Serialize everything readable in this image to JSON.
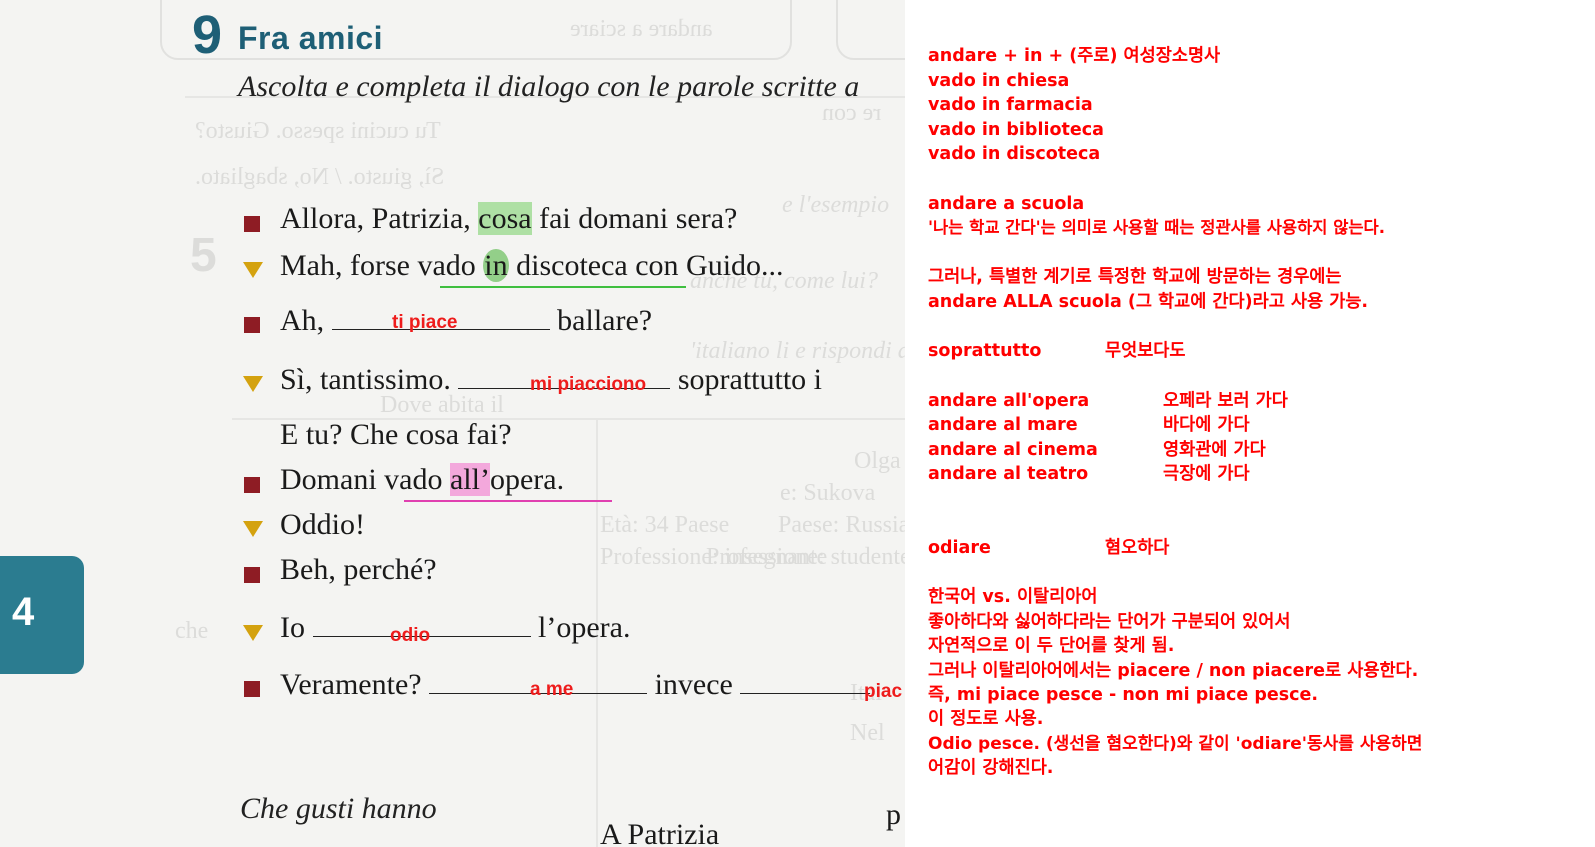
{
  "exercise": {
    "number": "9",
    "title": "Fra amici",
    "instruction": "Ascolta e completa il dialogo con le parole scritte a",
    "section_tab": "4",
    "footer_left": "Che gusti hanno",
    "footer_mid": "A Patrizia",
    "footer_right": "p"
  },
  "ghost_text": {
    "top_box": "andare a sciare",
    "q1": "Tu cucini spesso. Giusto?",
    "q2": "Sì, giusto. / No, sbagliato.",
    "frag1": "re con",
    "frag2": "e l'esempio",
    "num5": "5",
    "frag3": "anche tu, come lui?",
    "frag4": "'italiano li e rispondi alle domande",
    "frag5": "Dove abita il",
    "frag6": "Olga",
    "frag7": "e: Sukova",
    "frag8": "Paese: Russia",
    "frag9": "Età: 34 Paese",
    "frag10": "Professione: studentessa",
    "frag11": "Professione: insegnante",
    "frag12": "che",
    "frag13": "Ital",
    "frag14": "Nel"
  },
  "dialogue": {
    "l1": {
      "pre": "Allora, Patrizia, ",
      "hl": "cosa",
      "post": " fai domani sera?"
    },
    "l2": {
      "pre": "Mah, forse vado ",
      "hl": "in",
      "post": " discoteca con Guido..."
    },
    "l3": {
      "pre": "Ah, ",
      "post": " ballare?",
      "answer": "ti piace"
    },
    "l4": {
      "pre": "Sì, tantissimo. ",
      "post": " soprattutto i",
      "answer": "mi piacciono"
    },
    "l5": {
      "text": "E tu? Che cosa fai?"
    },
    "l6": {
      "pre": "Domani vado ",
      "hl": "all’",
      "post": "opera."
    },
    "l7": {
      "text": "Oddio!"
    },
    "l8": {
      "text": "Beh, perché?"
    },
    "l9": {
      "pre": "Io ",
      "post": " l’opera.",
      "answer": "odio"
    },
    "l10": {
      "pre": "Veramente? ",
      "mid": " invece ",
      "answer": "a me",
      "answer2": "piac"
    }
  },
  "notes": {
    "n1": "andare + in + (주로) 여성장소명사",
    "n2": "vado in chiesa",
    "n3": "vado in farmacia",
    "n4": "vado in biblioteca",
    "n5": "vado in discoteca",
    "n6": "andare a scuola",
    "n7": "'나는 학교 간다'는 의미로 사용할 때는 정관사를 사용하지 않는다.",
    "n8": "그러나, 특별한 계기로 특정한 학교에 방문하는 경우에는",
    "n9": "andare ALLA scuola (그 학교에 간다)라고 사용 가능.",
    "v1_term": "soprattutto",
    "v1_def": "무엇보다도",
    "v2_term": "andare all'opera",
    "v2_def": "오페라 보러 가다",
    "v3_term": "andare al mare",
    "v3_def": "바다에 가다",
    "v4_term": "andare al cinema",
    "v4_def": "영화관에 가다",
    "v5_term": "andare al teatro",
    "v5_def": "극장에 가다",
    "v6_term": "odiare",
    "v6_def": "혐오하다",
    "c1": "한국어 vs. 이탈리아어",
    "c2": "좋아하다와 싫어하다라는 단어가 구분되어 있어서",
    "c3": "자연적으로 이 두 단어를 찾게 됨.",
    "c4": "그러나 이탈리아어에서는 piacere / non piacere로 사용한다.",
    "c5": "즉, mi piace pesce - non mi piace pesce.",
    "c6": "이 정도로 사용.",
    "c7": "Odio pesce. (생선을 혐오한다)와 같이 'odiare'동사를 사용하면",
    "c8": "어감이 강해진다."
  },
  "colors": {
    "note_red": "#ff0000",
    "title_teal": "#1e5f76",
    "marker_red": "#8e1c24",
    "marker_yellow": "#d4a20f",
    "tab_teal": "#2b7c90"
  }
}
